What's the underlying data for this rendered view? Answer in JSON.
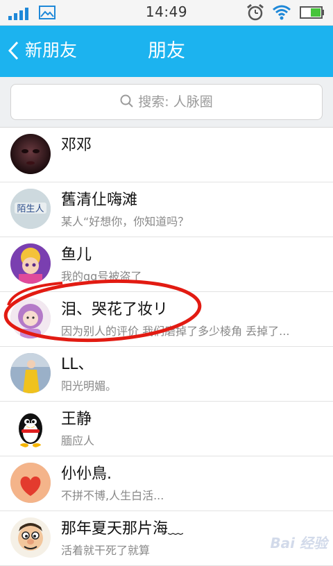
{
  "status_bar": {
    "time": "14:49",
    "icons": [
      "signal-icon",
      "picture-icon",
      "alarm-icon",
      "wifi-icon",
      "battery-icon"
    ]
  },
  "header": {
    "back_label": "新朋友",
    "title": "朋友",
    "background": "#1cb3ef"
  },
  "search": {
    "placeholder": "搜索: 人脉圈"
  },
  "friends": [
    {
      "name": "邓邓",
      "status": "",
      "avatar": "dark-face-photo"
    },
    {
      "name": "舊清仩嗨滩",
      "status": "某人“好想你，你知道吗？",
      "avatar": "stranger-text-avatar"
    },
    {
      "name": "鱼儿",
      "status": "我的qq号被盗了",
      "avatar": "cartoon-girl-avatar"
    },
    {
      "name": "泪、哭花了妆リ",
      "status": "因为别人的评价 我们磨掉了多少棱角 丢掉了...",
      "avatar": "purple-hood-baby-avatar"
    },
    {
      "name": "  LL、",
      "status": "阳光明媚。",
      "avatar": "yellow-dress-girl-photo"
    },
    {
      "name": "王静",
      "status": "腼应人",
      "avatar": "qq-penguin-avatar"
    },
    {
      "name": "仦仦鳥.",
      "status": "不拼不博,人生白活...",
      "avatar": "red-heart-avatar"
    },
    {
      "name": "那年夏天那片海﹏",
      "status": "活着就干死了就算",
      "avatar": "cartoon-man-avatar"
    }
  ],
  "watermark": "Bai 经验"
}
